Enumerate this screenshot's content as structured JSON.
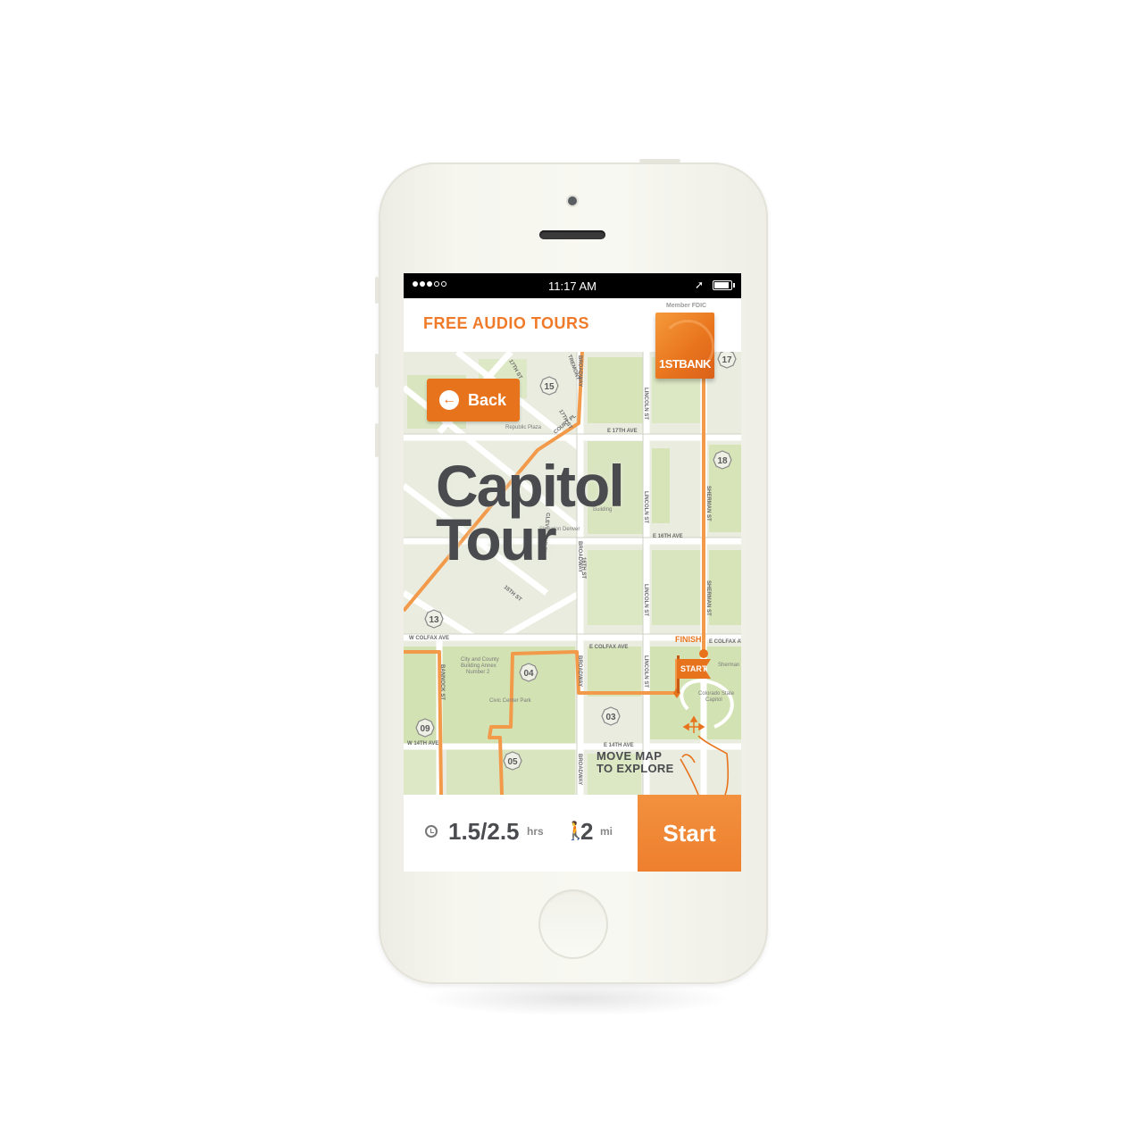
{
  "statusbar": {
    "time": "11:17 AM",
    "signal_dots": 5,
    "signal_filled": 3,
    "location_icon": "location-arrow-icon",
    "battery_icon": "battery-icon"
  },
  "header": {
    "title": "FREE AUDIO TOURS",
    "fdic": "Member FDIC",
    "brand_mark": "1STBANK"
  },
  "map": {
    "back_label": "Back",
    "tour_title_line1": "Capitol",
    "tour_title_line2": "Tour",
    "hint_line1": "MOVE MAP",
    "hint_line2": "TO EXPLORE",
    "finish_label": "FINISH",
    "start_label": "START",
    "street_labels": [
      "17TH ST",
      "TREMONT",
      "BROADWAY",
      "E 17TH AVE",
      "LINCOLN ST",
      "E 16TH AVE",
      "SHERMAN ST",
      "16TH ST",
      "15TH ST",
      "W COLFAX AVE",
      "E COLFAX AVE",
      "BANNOCK ST",
      "W 14TH AVE",
      "E 14TH AVE",
      "CLEVELAND PL",
      "COURT PL"
    ],
    "place_labels": [
      "Republic Plaza",
      "Building",
      "Sheraton Denver",
      "City and County Building Annex Number 2",
      "Civic Center Park",
      "Colorado State Capitol",
      "Sherman St"
    ],
    "stops": [
      "15",
      "18",
      "13",
      "04",
      "03",
      "09",
      "05",
      "17"
    ]
  },
  "bottombar": {
    "duration_value": "1.5/2.5",
    "duration_unit": "hrs",
    "distance_value": "2",
    "distance_unit": "mi",
    "start_label": "Start"
  },
  "colors": {
    "accent": "#e8731d",
    "route": "#f29a4a",
    "map_bg": "#e9ecdf",
    "park": "#d6e4b8",
    "text_dark": "#4a4b4f"
  }
}
